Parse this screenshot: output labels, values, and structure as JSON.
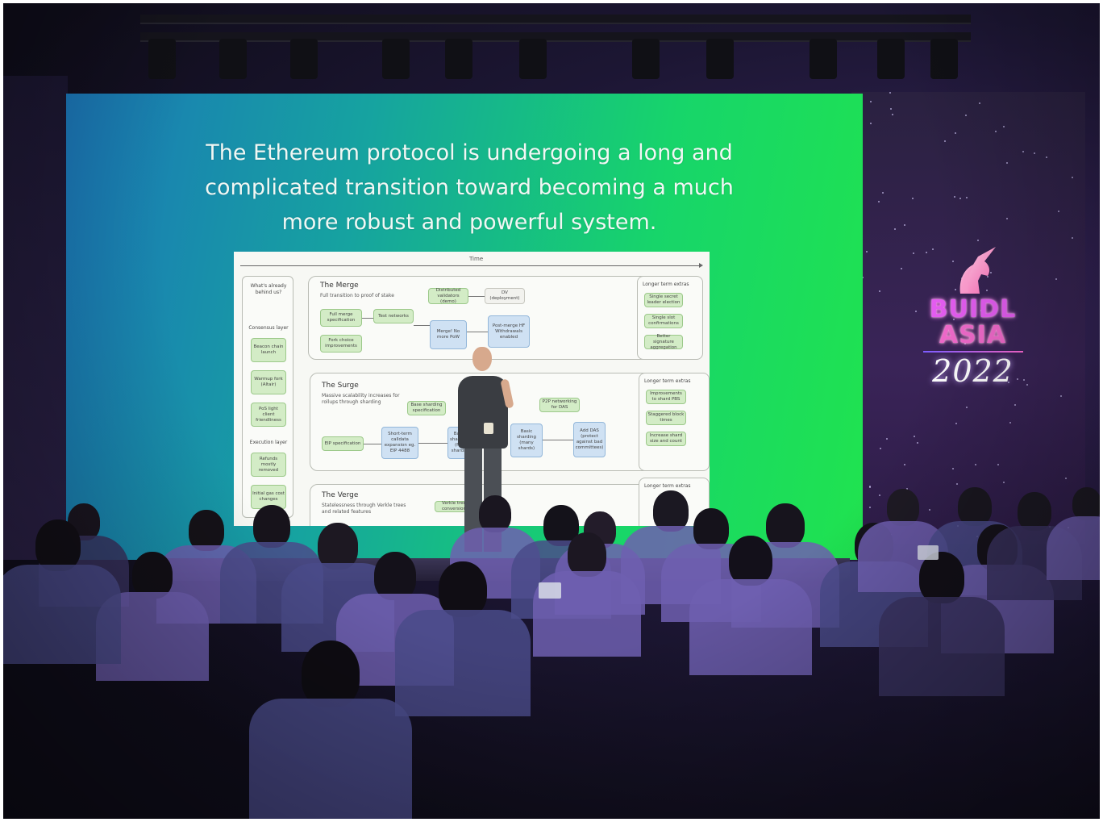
{
  "slide": {
    "headline_line1": "The Ethereum protocol is undergoing a long and",
    "headline_line2": "complicated transition toward becoming a much",
    "headline_line3": "more robust and powerful system."
  },
  "roadmap": {
    "time_label": "Time",
    "behind": {
      "title": "What's already behind us?",
      "consensus_label": "Consensus layer",
      "consensus_items": [
        "Beacon chain launch",
        "Warmup fork (Altair)",
        "PoS light client friendliness"
      ],
      "execution_label": "Execution layer",
      "execution_items": [
        "Refunds mostly removed",
        "Initial gas cost changes"
      ]
    },
    "merge": {
      "title": "The Merge",
      "subtitle": "Full transition to proof of stake",
      "nodes": {
        "distributed_validators": "Distributed validators (demo)",
        "dv_deployment": "DV (deployment)",
        "full_merge_spec": "Full merge specification",
        "test_networks": "Test networks",
        "merge": "Merge! No more PoW",
        "post_merge": "Post-merge HF Withdrawals enabled",
        "fork_choice": "Fork choice improvements"
      },
      "extras_title": "Longer term extras",
      "extras": [
        "Single secret leader election",
        "Single slot confirmations",
        "Better signature aggregation"
      ]
    },
    "surge": {
      "title": "The Surge",
      "subtitle": "Massive scalability increases for rollups through sharding",
      "nodes": {
        "eip_spec": "EIP specification",
        "short_term": "Short-term calldata expansion eg. EIP 4488",
        "basic_few": "Basic sharding (few shards)",
        "base_spec": "Base sharding specification",
        "p2p": "P2P networking for DAS",
        "basic_many": "Basic sharding (many shards)",
        "add_das": "Add DAS (protect against bad committees)"
      },
      "extras_title": "Longer term extras",
      "extras": [
        "Improvements to shard PBS",
        "Staggered block times",
        "Increase shard size and count"
      ]
    },
    "verge": {
      "title": "The Verge",
      "subtitle": "Statelessness through Verkle trees and related features",
      "nodes": {
        "verkle": "Verkle tree conversion"
      },
      "extras_title": "Longer term extras"
    }
  },
  "event": {
    "brand_line1": "BUIDL",
    "brand_line2": "ASIA",
    "brand_year": "2022"
  },
  "colors": {
    "screen_start": "#1b76b8",
    "screen_end": "#20e34f",
    "brand_magenta": "#e35cf0",
    "brand_pink": "#f06acb"
  }
}
